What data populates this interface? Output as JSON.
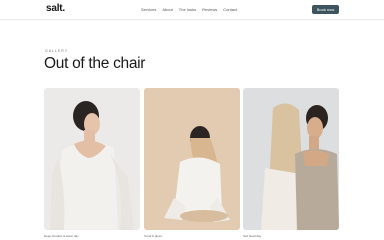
{
  "brand": {
    "logo": "salt."
  },
  "nav": {
    "items": [
      {
        "label": "Services"
      },
      {
        "label": "About"
      },
      {
        "label": "The looks"
      },
      {
        "label": "Reviews"
      },
      {
        "label": "Contact"
      }
    ],
    "cta_label": "Book now"
  },
  "gallery": {
    "eyebrow": "GALLERY",
    "title": "Out of the chair",
    "items": [
      {
        "caption": "Deep shadow & wave day",
        "icon": "photo"
      },
      {
        "caption": "Tonal & gloss",
        "icon": "photo"
      },
      {
        "caption": "Sell head day",
        "icon": "photo"
      }
    ]
  },
  "colors": {
    "accent": "#3e5560",
    "background": "#ffffff"
  }
}
